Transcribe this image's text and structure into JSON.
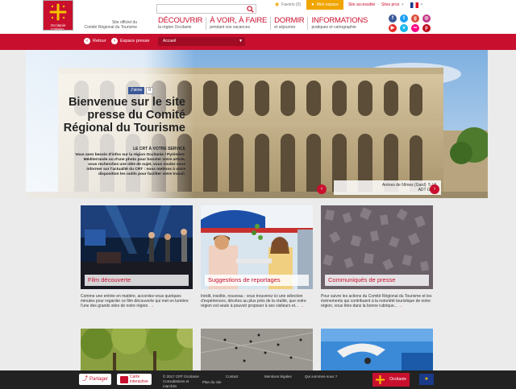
{
  "header": {
    "logo_text": "Occitanie",
    "logo_subtext": "PYRÉNÉES - MÉDITERRANÉE",
    "site_official_line1": "Site officiel du",
    "site_official_line2": "Comité Régional du Tourisme",
    "search": {
      "placeholder": "",
      "value": ""
    },
    "favoris": "Favoris (0)",
    "mon_espace": "Mon espace",
    "site_accessible": "Site accessible",
    "sites_pros": "Sites pros",
    "language_code": "FR",
    "nav": [
      {
        "main": "DÉCOUVRIR",
        "sub": "la région Occitanie"
      },
      {
        "main": "À VOIR, À FAIRE",
        "sub": "pendant vos vacances"
      },
      {
        "main": "DORMIR",
        "sub": "et séjourner"
      },
      {
        "main": "INFORMATIONS",
        "sub": "pratiques et cartographie"
      }
    ],
    "social_icons": [
      "facebook-icon",
      "twitter-icon",
      "google-plus-icon",
      "instagram-icon",
      "youtube-icon",
      "vimeo-icon",
      "flickr-icon",
      "pinterest-icon"
    ]
  },
  "redbar": {
    "retour": "Retour",
    "espace_presse": "Espace presse",
    "select_value": "Accueil"
  },
  "hero": {
    "fb_like": "J'aime",
    "fb_count": "0",
    "title": "Bienvenue sur le site presse du Comité Régional du Tourisme",
    "kicker": "LE CRT À VOTRE SERVICE",
    "text": "Vous avez besoin d'infos sur la région Occitanie / Pyrénées-Méditerranée ou d'une photo pour booster votre article, vous recherchez une idée de sujet, vous voulez vous informer sur l'actualité du CRT : nous mettons à votre disposition les outils pour faciliter votre travail.",
    "caption_title": "Arènes de Nîmes (Gard)",
    "caption_page": "5 / 8",
    "caption_credit": "ADT Gard"
  },
  "cards": [
    {
      "label": "Film découverte",
      "desc": "Comme une entrée en matière, accordez-vous quelques minutes pour regarder ce film découverte qui met en lumière l'une des grands sites de notre région."
    },
    {
      "label": "Suggestions de reportages",
      "desc": "Inédit, insolite, nouveau : vous trouverez ici une sélection d'expériences, décrites au plus près de la réalité, que notre région est seule à pouvoir proposer à ses visiteurs et..."
    },
    {
      "label": "Communiqués de presse",
      "desc": "Pour suivre les actions du Comité Régional du Tourisme et les évènements qui contribuent à la notoriété touristique de notre région, vous êtes dans la bonne rubrique..."
    }
  ],
  "footer": {
    "partager": "Partager",
    "carte_line1": "Carte",
    "carte_line2": "interactive",
    "copyright": "© 2017 CRT Occitanie",
    "consultations": "Consultations et marchés",
    "contact": "Contact",
    "plan": "Plan du site",
    "mentions": "Mentions légales",
    "qui": "Qui sommes-nous ?",
    "logo_text": "Occitanie"
  },
  "colors": {
    "brand_red": "#c8102e",
    "accent_orange": "#f0a500",
    "footer_bg": "#222222"
  }
}
